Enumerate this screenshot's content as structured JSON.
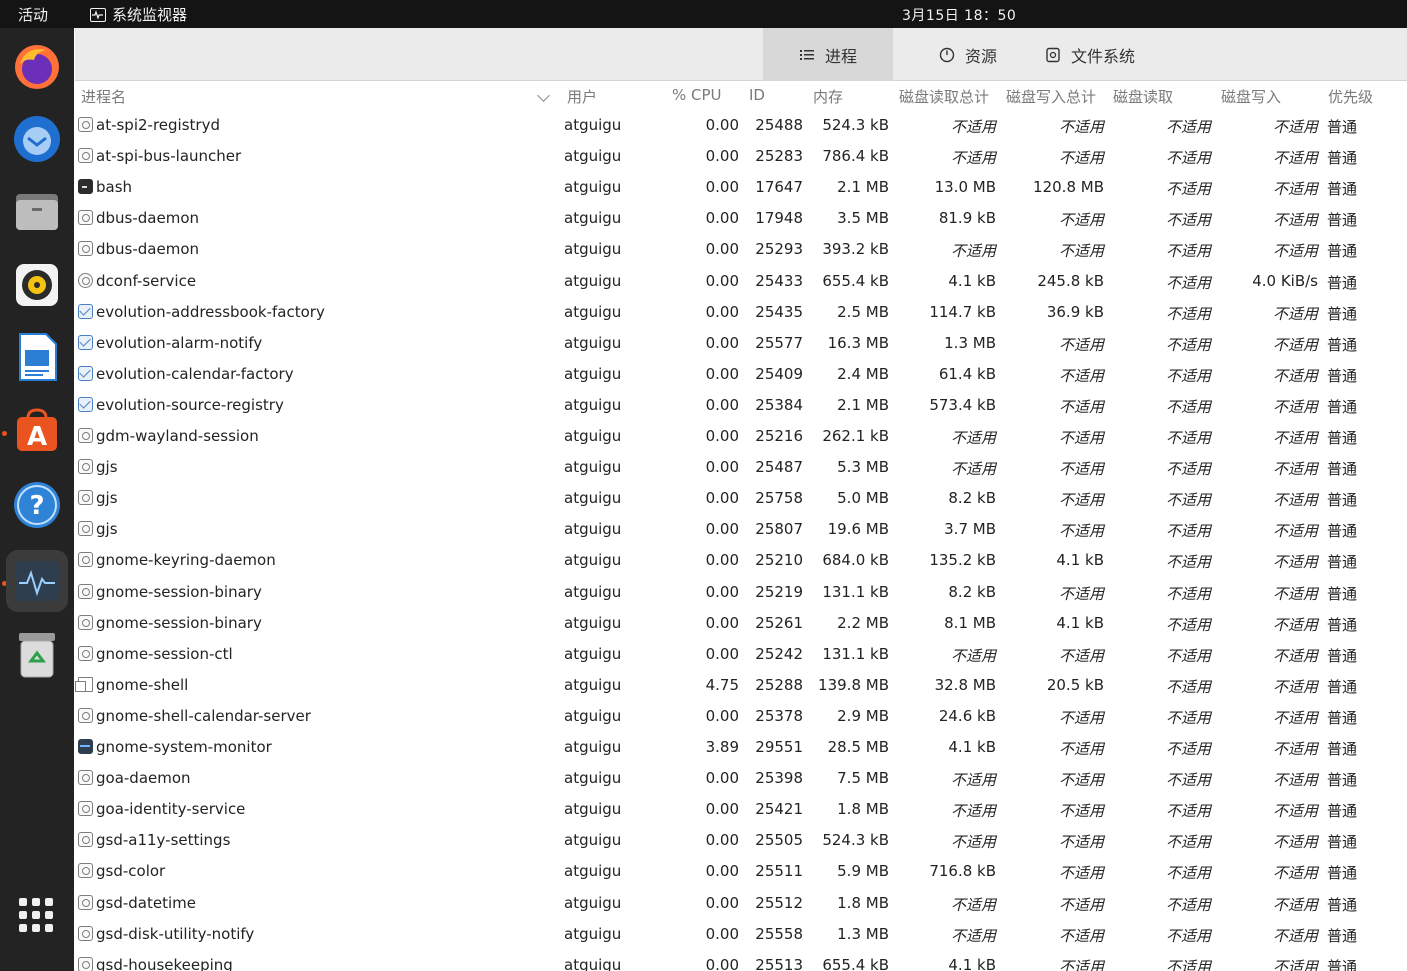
{
  "topbar": {
    "activities": "活动",
    "app_name": "系统监视器",
    "clock": "3月15日 18：50"
  },
  "dock": {
    "items": [
      "firefox-icon",
      "thunderbird-icon",
      "files-icon",
      "rhythmbox-icon",
      "libreoffice-writer-icon",
      "ubuntu-software-icon",
      "help-icon",
      "system-monitor-icon",
      "trash-icon"
    ],
    "show_apps": "show-applications-icon"
  },
  "tabs": [
    {
      "label": "进程",
      "icon": "list-icon",
      "active": true
    },
    {
      "label": "资源",
      "icon": "gauge-icon",
      "active": false
    },
    {
      "label": "文件系统",
      "icon": "disk-icon",
      "active": false
    }
  ],
  "columns": {
    "name": "进程名",
    "user": "用户",
    "cpu": "% CPU",
    "id": "ID",
    "memory": "内存",
    "disk_read_total": "磁盘读取总计",
    "disk_write_total": "磁盘写入总计",
    "disk_read": "磁盘读取",
    "disk_write": "磁盘写入",
    "priority": "优先级"
  },
  "processes": [
    {
      "icon": "gear",
      "name": "at-spi2-registryd",
      "user": "atguigu",
      "cpu": "0.00",
      "id": "25488",
      "mem": "524.3 kB",
      "drt": "不适用",
      "dwt": "不适用",
      "dr": "不适用",
      "dw": "不适用",
      "pri": "普通"
    },
    {
      "icon": "gear",
      "name": "at-spi-bus-launcher",
      "user": "atguigu",
      "cpu": "0.00",
      "id": "25283",
      "mem": "786.4 kB",
      "drt": "不适用",
      "dwt": "不适用",
      "dr": "不适用",
      "dw": "不适用",
      "pri": "普通"
    },
    {
      "icon": "term",
      "name": "bash",
      "user": "atguigu",
      "cpu": "0.00",
      "id": "17647",
      "mem": "2.1 MB",
      "drt": "13.0 MB",
      "dwt": "120.8 MB",
      "dr": "不适用",
      "dw": "不适用",
      "pri": "普通"
    },
    {
      "icon": "gear",
      "name": "dbus-daemon",
      "user": "atguigu",
      "cpu": "0.00",
      "id": "17948",
      "mem": "3.5 MB",
      "drt": "81.9 kB",
      "dwt": "不适用",
      "dr": "不适用",
      "dw": "不适用",
      "pri": "普通"
    },
    {
      "icon": "gear",
      "name": "dbus-daemon",
      "user": "atguigu",
      "cpu": "0.00",
      "id": "25293",
      "mem": "393.2 kB",
      "drt": "不适用",
      "dwt": "不适用",
      "dr": "不适用",
      "dw": "不适用",
      "pri": "普通"
    },
    {
      "icon": "conf",
      "name": "dconf-service",
      "user": "atguigu",
      "cpu": "0.00",
      "id": "25433",
      "mem": "655.4 kB",
      "drt": "4.1 kB",
      "dwt": "245.8 kB",
      "dr": "不适用",
      "dw": "4.0 KiB/s",
      "pri": "普通"
    },
    {
      "icon": "mail",
      "name": "evolution-addressbook-factory",
      "user": "atguigu",
      "cpu": "0.00",
      "id": "25435",
      "mem": "2.5 MB",
      "drt": "114.7 kB",
      "dwt": "36.9 kB",
      "dr": "不适用",
      "dw": "不适用",
      "pri": "普通"
    },
    {
      "icon": "mail",
      "name": "evolution-alarm-notify",
      "user": "atguigu",
      "cpu": "0.00",
      "id": "25577",
      "mem": "16.3 MB",
      "drt": "1.3 MB",
      "dwt": "不适用",
      "dr": "不适用",
      "dw": "不适用",
      "pri": "普通"
    },
    {
      "icon": "mail",
      "name": "evolution-calendar-factory",
      "user": "atguigu",
      "cpu": "0.00",
      "id": "25409",
      "mem": "2.4 MB",
      "drt": "61.4 kB",
      "dwt": "不适用",
      "dr": "不适用",
      "dw": "不适用",
      "pri": "普通"
    },
    {
      "icon": "mail",
      "name": "evolution-source-registry",
      "user": "atguigu",
      "cpu": "0.00",
      "id": "25384",
      "mem": "2.1 MB",
      "drt": "573.4 kB",
      "dwt": "不适用",
      "dr": "不适用",
      "dw": "不适用",
      "pri": "普通"
    },
    {
      "icon": "gear",
      "name": "gdm-wayland-session",
      "user": "atguigu",
      "cpu": "0.00",
      "id": "25216",
      "mem": "262.1 kB",
      "drt": "不适用",
      "dwt": "不适用",
      "dr": "不适用",
      "dw": "不适用",
      "pri": "普通"
    },
    {
      "icon": "gear",
      "name": "gjs",
      "user": "atguigu",
      "cpu": "0.00",
      "id": "25487",
      "mem": "5.3 MB",
      "drt": "不适用",
      "dwt": "不适用",
      "dr": "不适用",
      "dw": "不适用",
      "pri": "普通"
    },
    {
      "icon": "gear",
      "name": "gjs",
      "user": "atguigu",
      "cpu": "0.00",
      "id": "25758",
      "mem": "5.0 MB",
      "drt": "8.2 kB",
      "dwt": "不适用",
      "dr": "不适用",
      "dw": "不适用",
      "pri": "普通"
    },
    {
      "icon": "gear",
      "name": "gjs",
      "user": "atguigu",
      "cpu": "0.00",
      "id": "25807",
      "mem": "19.6 MB",
      "drt": "3.7 MB",
      "dwt": "不适用",
      "dr": "不适用",
      "dw": "不适用",
      "pri": "普通"
    },
    {
      "icon": "gear",
      "name": "gnome-keyring-daemon",
      "user": "atguigu",
      "cpu": "0.00",
      "id": "25210",
      "mem": "684.0 kB",
      "drt": "135.2 kB",
      "dwt": "4.1 kB",
      "dr": "不适用",
      "dw": "不适用",
      "pri": "普通"
    },
    {
      "icon": "gear",
      "name": "gnome-session-binary",
      "user": "atguigu",
      "cpu": "0.00",
      "id": "25219",
      "mem": "131.1 kB",
      "drt": "8.2 kB",
      "dwt": "不适用",
      "dr": "不适用",
      "dw": "不适用",
      "pri": "普通"
    },
    {
      "icon": "gear",
      "name": "gnome-session-binary",
      "user": "atguigu",
      "cpu": "0.00",
      "id": "25261",
      "mem": "2.2 MB",
      "drt": "8.1 MB",
      "dwt": "4.1 kB",
      "dr": "不适用",
      "dw": "不适用",
      "pri": "普通"
    },
    {
      "icon": "gear",
      "name": "gnome-session-ctl",
      "user": "atguigu",
      "cpu": "0.00",
      "id": "25242",
      "mem": "131.1 kB",
      "drt": "不适用",
      "dwt": "不适用",
      "dr": "不适用",
      "dw": "不适用",
      "pri": "普通"
    },
    {
      "icon": "win",
      "name": "gnome-shell",
      "user": "atguigu",
      "cpu": "4.75",
      "id": "25288",
      "mem": "139.8 MB",
      "drt": "32.8 MB",
      "dwt": "20.5 kB",
      "dr": "不适用",
      "dw": "不适用",
      "pri": "普通"
    },
    {
      "icon": "gear",
      "name": "gnome-shell-calendar-server",
      "user": "atguigu",
      "cpu": "0.00",
      "id": "25378",
      "mem": "2.9 MB",
      "drt": "24.6 kB",
      "dwt": "不适用",
      "dr": "不适用",
      "dw": "不适用",
      "pri": "普通"
    },
    {
      "icon": "mon",
      "name": "gnome-system-monitor",
      "user": "atguigu",
      "cpu": "3.89",
      "id": "29551",
      "mem": "28.5 MB",
      "drt": "4.1 kB",
      "dwt": "不适用",
      "dr": "不适用",
      "dw": "不适用",
      "pri": "普通"
    },
    {
      "icon": "gear",
      "name": "goa-daemon",
      "user": "atguigu",
      "cpu": "0.00",
      "id": "25398",
      "mem": "7.5 MB",
      "drt": "不适用",
      "dwt": "不适用",
      "dr": "不适用",
      "dw": "不适用",
      "pri": "普通"
    },
    {
      "icon": "gear",
      "name": "goa-identity-service",
      "user": "atguigu",
      "cpu": "0.00",
      "id": "25421",
      "mem": "1.8 MB",
      "drt": "不适用",
      "dwt": "不适用",
      "dr": "不适用",
      "dw": "不适用",
      "pri": "普通"
    },
    {
      "icon": "gear",
      "name": "gsd-a11y-settings",
      "user": "atguigu",
      "cpu": "0.00",
      "id": "25505",
      "mem": "524.3 kB",
      "drt": "不适用",
      "dwt": "不适用",
      "dr": "不适用",
      "dw": "不适用",
      "pri": "普通"
    },
    {
      "icon": "gear",
      "name": "gsd-color",
      "user": "atguigu",
      "cpu": "0.00",
      "id": "25511",
      "mem": "5.9 MB",
      "drt": "716.8 kB",
      "dwt": "不适用",
      "dr": "不适用",
      "dw": "不适用",
      "pri": "普通"
    },
    {
      "icon": "gear",
      "name": "gsd-datetime",
      "user": "atguigu",
      "cpu": "0.00",
      "id": "25512",
      "mem": "1.8 MB",
      "drt": "不适用",
      "dwt": "不适用",
      "dr": "不适用",
      "dw": "不适用",
      "pri": "普通"
    },
    {
      "icon": "gear",
      "name": "gsd-disk-utility-notify",
      "user": "atguigu",
      "cpu": "0.00",
      "id": "25558",
      "mem": "1.3 MB",
      "drt": "不适用",
      "dwt": "不适用",
      "dr": "不适用",
      "dw": "不适用",
      "pri": "普通"
    },
    {
      "icon": "gear",
      "name": "gsd-housekeeping",
      "user": "atguigu",
      "cpu": "0.00",
      "id": "25513",
      "mem": "655.4 kB",
      "drt": "4.1 kB",
      "dwt": "不适用",
      "dr": "不适用",
      "dw": "不适用",
      "pri": "普通"
    }
  ]
}
